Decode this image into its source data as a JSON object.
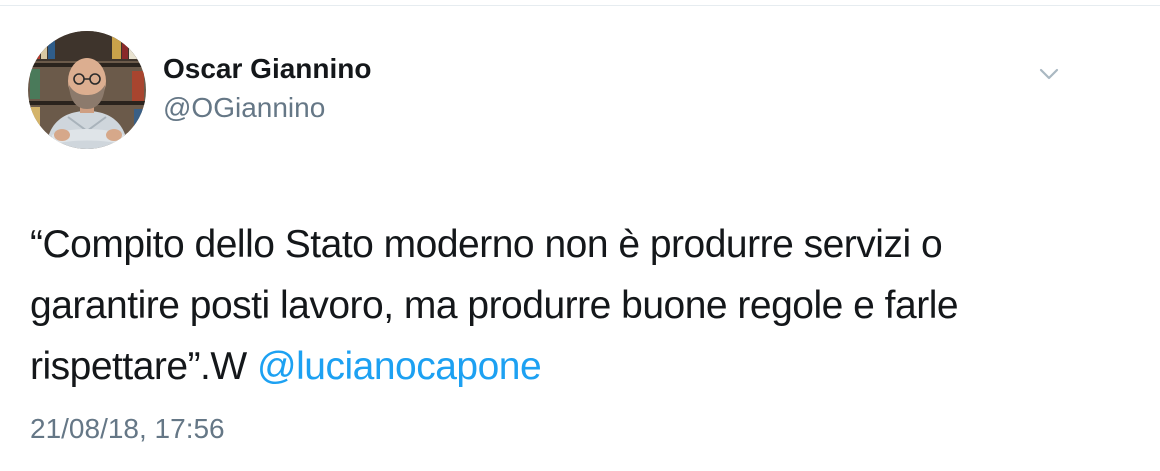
{
  "user": {
    "display_name": "Oscar Giannino",
    "handle": "@OGiannino"
  },
  "tweet": {
    "text_line1": "“Compito dello Stato moderno non è produrre servizi o",
    "text_line2": "garantire posti lavoro, ma produrre buone regole e farle",
    "text_line3": "rispettare”.W ",
    "mention": "@lucianocapone",
    "timestamp": "21/08/18, 17:56"
  },
  "icons": {
    "menu": "chevron-down-icon",
    "avatar": "profile-photo"
  },
  "colors": {
    "text": "#14171a",
    "secondary": "#657786",
    "link": "#1da1f2"
  }
}
